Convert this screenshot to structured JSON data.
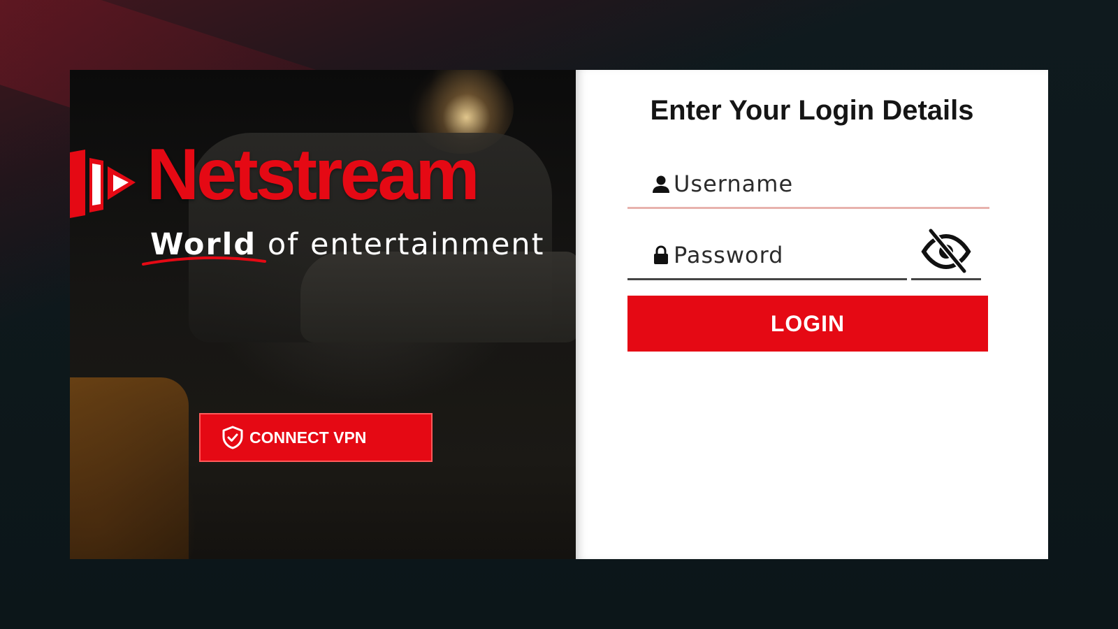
{
  "brand": {
    "name": "Netstream",
    "tagline_strong": "World",
    "tagline_rest": "of entertainment",
    "accent_color": "#e50914"
  },
  "vpn": {
    "label": "CONNECT VPN",
    "icon": "shield-check-icon"
  },
  "login": {
    "title": "Enter Your Login Details",
    "username_placeholder": "Username",
    "username_value": "",
    "username_icon": "user-icon",
    "password_placeholder": "Password",
    "password_value": "",
    "password_icon": "lock-icon",
    "visibility_icon": "eye-off-icon",
    "button_label": "LOGIN"
  }
}
